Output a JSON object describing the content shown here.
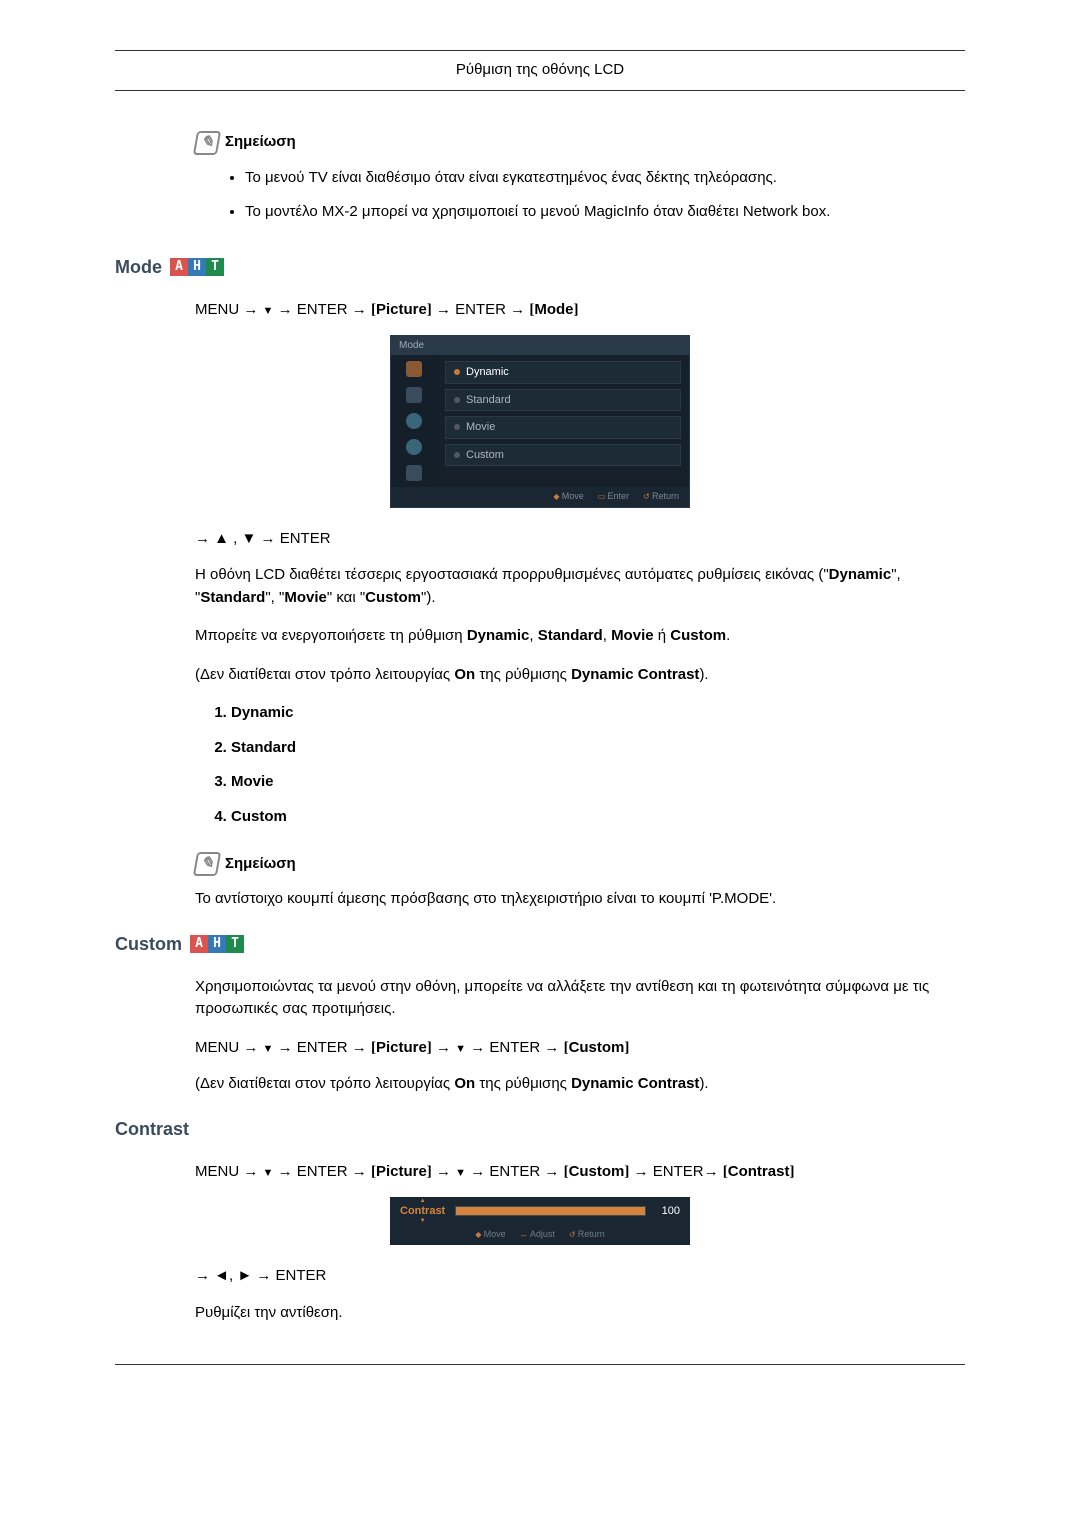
{
  "header": {
    "title": "Ρύθμιση της οθόνης LCD"
  },
  "note1": {
    "label": "Σημείωση",
    "bullets": [
      "Το μενού TV είναι διαθέσιμο όταν είναι εγκατεστημένος ένας δέκτης τηλεόρασης.",
      "Το μοντέλο MX-2 μπορεί να χρησιμοποιεί το μενού MagicInfo όταν διαθέτει Network box."
    ]
  },
  "mode": {
    "heading": "Mode",
    "path": {
      "menu": "MENU →",
      "enter1": "→ ENTER →",
      "picture": "Picture",
      "enter2": "→ ENTER →",
      "modeBracket": "Mode"
    },
    "osd": {
      "title": "Mode",
      "items": [
        "Dynamic",
        "Standard",
        "Movie",
        "Custom"
      ],
      "foot": {
        "move": "Move",
        "enter": "Enter",
        "return": "Return"
      }
    },
    "nav2": "→ ▲ , ▼ → ENTER",
    "para1a": "Η οθόνη LCD διαθέτει τέσσερις εργοστασιακά προρρυθμισμένες αυτόματες ρυθμίσεις εικόνας (\"",
    "para1b": "\", \"",
    "para1c": "\", \"",
    "para1d": "\" και \"",
    "para1e": "\").",
    "para2a": "Μπορείτε να ενεργοποιήσετε τη ρύθμιση ",
    "para2b": " ή ",
    "para2c": ".",
    "para3a": "(Δεν διατίθεται στον τρόπο λειτουργίας ",
    "para3b": " της ρύθμισης ",
    "para3c": ").",
    "on": "On",
    "dc": "Dynamic Contrast",
    "list": [
      "Dynamic",
      "Standard",
      "Movie",
      "Custom"
    ],
    "note2label": "Σημείωση",
    "note2text": "Το αντίστοιχο κουμπί άμεσης πρόσβασης στο τηλεχειριστήριο είναι το κουμπί 'P.MODE'."
  },
  "custom": {
    "heading": "Custom",
    "para": "Χρησιμοποιώντας τα μενού στην οθόνη, μπορείτε να αλλάξετε την αντίθεση και τη φωτεινότητα σύμφωνα με τις προσωπικές σας προτιμήσεις.",
    "path": {
      "menu": "MENU →",
      "enter1": "→ ENTER →",
      "picture": "Picture",
      "arrow": "→",
      "enter2": "→ ENTER →",
      "customBracket": "Custom"
    },
    "para2a": "(Δεν διατίθεται στον τρόπο λειτουργίας ",
    "on": "On",
    "para2b": " της ρύθμισης ",
    "dc": "Dynamic Contrast",
    "para2c": ")."
  },
  "contrast": {
    "heading": "Contrast",
    "path": {
      "menu": "MENU →",
      "enter1": "→ ENTER →",
      "picture": "Picture",
      "arrow": "→",
      "enter2": "→ ENTER →",
      "customBracket": "Custom",
      "enter3": "→ ENTER→",
      "contrastBracket": "Contrast"
    },
    "osd": {
      "label": "Contrast",
      "value": "100",
      "foot": {
        "move": "Move",
        "adjust": "Adjust",
        "return": "Return"
      }
    },
    "nav2": "→ ◄, ► → ENTER",
    "para": "Ρυθμίζει την αντίθεση."
  }
}
